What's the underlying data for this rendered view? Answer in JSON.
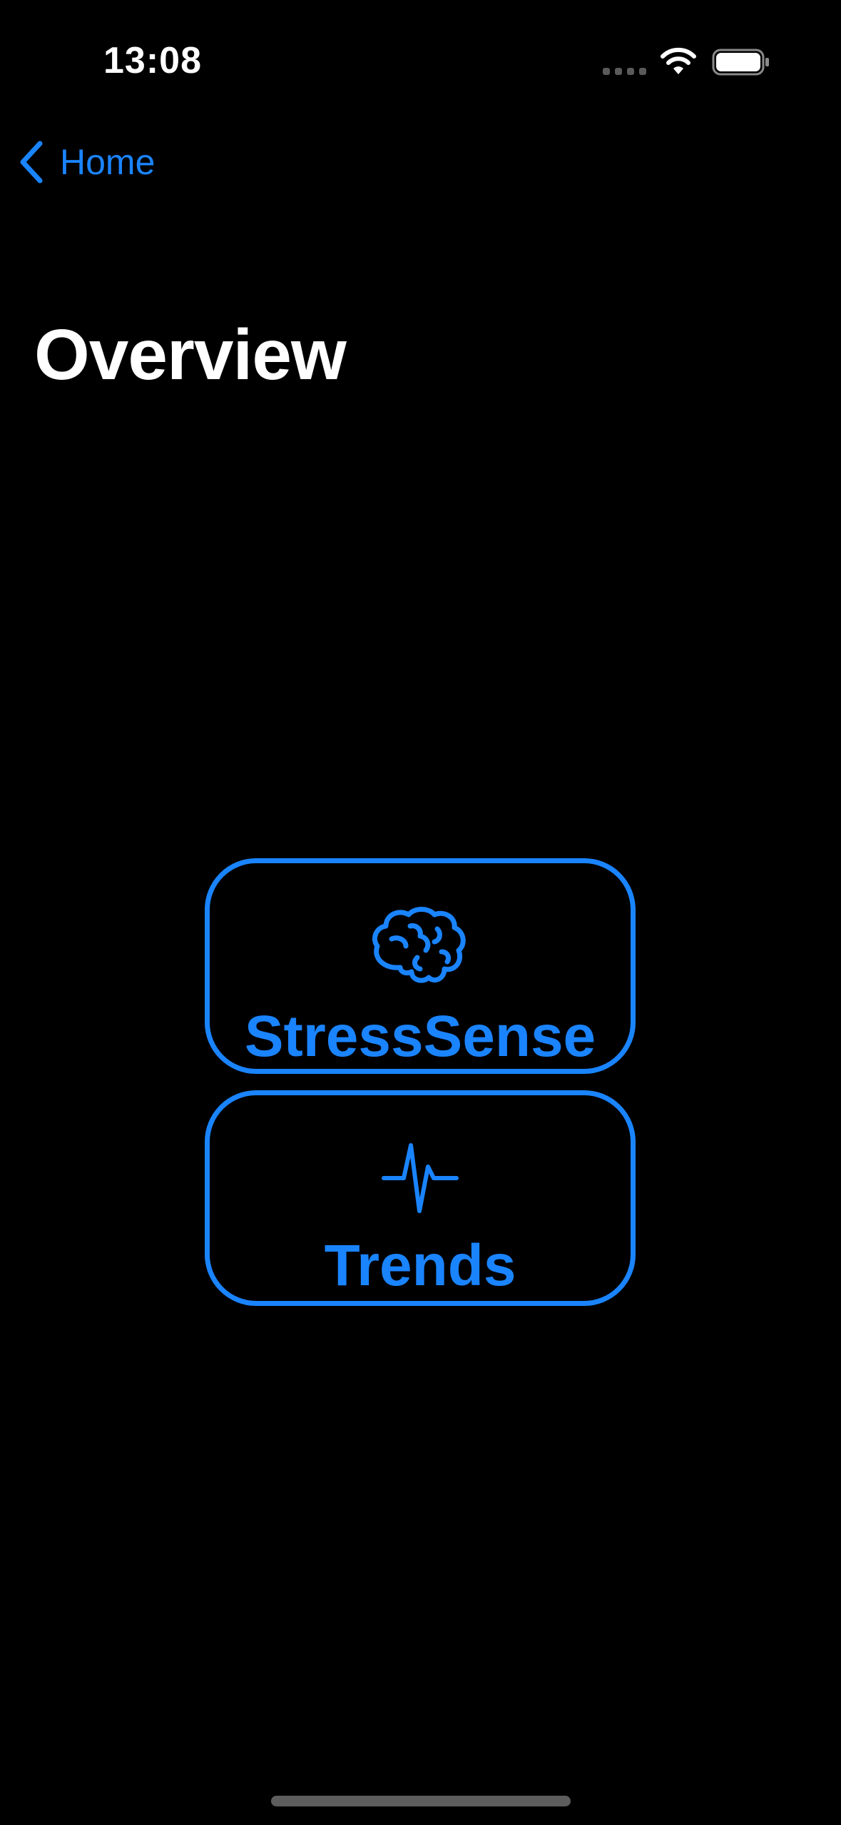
{
  "status_bar": {
    "time": "13:08",
    "icons": [
      "signal-dots-icon",
      "wifi-icon",
      "battery-icon"
    ]
  },
  "nav": {
    "back_label": "Home",
    "back_icon": "chevron-left-icon"
  },
  "page": {
    "title": "Overview"
  },
  "tiles": [
    {
      "label": "StressSense",
      "icon": "brain-icon"
    },
    {
      "label": "Trends",
      "icon": "waveform-icon"
    }
  ],
  "colors": {
    "background": "#000000",
    "accent": "#1a84ff",
    "text_primary": "#ffffff",
    "home_indicator": "#5d5d5d"
  }
}
